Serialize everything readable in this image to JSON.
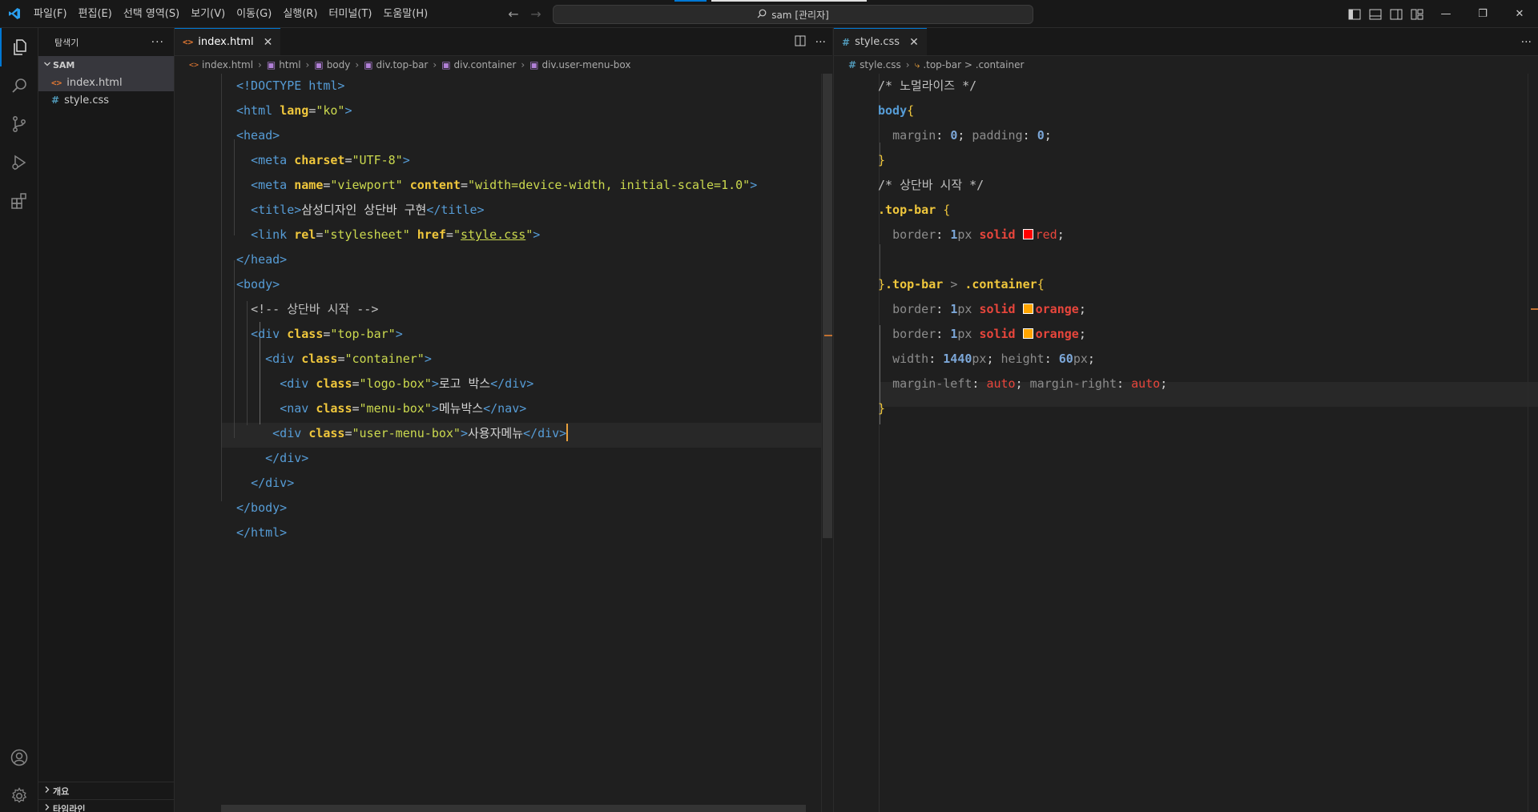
{
  "titlebar": {
    "menus": [
      "파일(F)",
      "편집(E)",
      "선택 영역(S)",
      "보기(V)",
      "이동(G)",
      "실행(R)",
      "터미널(T)",
      "도움말(H)"
    ],
    "search_text": "sam [관리자]",
    "accent_colors": [
      "#0078d4",
      "#ffffff"
    ]
  },
  "sidebar": {
    "title": "탐색기",
    "folder": "SAM",
    "files": [
      {
        "name": "index.html",
        "icon": "html-file-icon",
        "color": "#e37933"
      },
      {
        "name": "style.css",
        "icon": "css-file-icon",
        "color": "#519aba"
      }
    ],
    "sections": [
      "개요",
      "타임라인"
    ]
  },
  "left_editor": {
    "tab_label": "index.html",
    "breadcrumbs": [
      "index.html",
      "html",
      "body",
      "div.top-bar",
      "div.container",
      "div.user-menu-box"
    ]
  },
  "right_editor": {
    "tab_label": "style.css",
    "breadcrumbs": [
      "style.css",
      ".top-bar > .container"
    ]
  },
  "html_code": {
    "doctype": "<!DOCTYPE html>",
    "lang": "\"ko\"",
    "charset": "\"UTF-8\"",
    "viewport": "\"viewport\"",
    "viewport_content": "\"width=device-width, initial-scale=1.0\"",
    "title_text": "삼성디자인 상단바 구현",
    "rel": "\"stylesheet\"",
    "href": "style.css",
    "comment": "<!-- 상단바 시작 -->",
    "top_bar_class": "\"top-bar\"",
    "container_class": "\"container\"",
    "logo_class": "\"logo-box\"",
    "logo_text": "로고 박스",
    "menu_class": "\"menu-box\"",
    "menu_text": "메뉴박스",
    "user_class": "\"user-menu-box\"",
    "user_text": "사용자메뉴"
  },
  "css_code": {
    "comment1": "/* 노멀라이즈 */",
    "body_selector": "body",
    "margin_prop": "margin",
    "padding_prop": "padding",
    "zero": "0",
    "comment2": "/* 상단바 시작 */",
    "topbar_selector": ".top-bar",
    "border_prop": "border",
    "one": "1",
    "px": "px",
    "solid": "solid",
    "red": "red",
    "red_color": "#ff0000",
    "container_selector": ".container",
    "orange": "orange",
    "orange_color": "#ffa500",
    "width_prop": "width",
    "width_val": "1440",
    "height_prop": "height",
    "height_val": "60",
    "ml_prop": "margin-left",
    "mr_prop": "margin-right",
    "auto": "auto"
  }
}
